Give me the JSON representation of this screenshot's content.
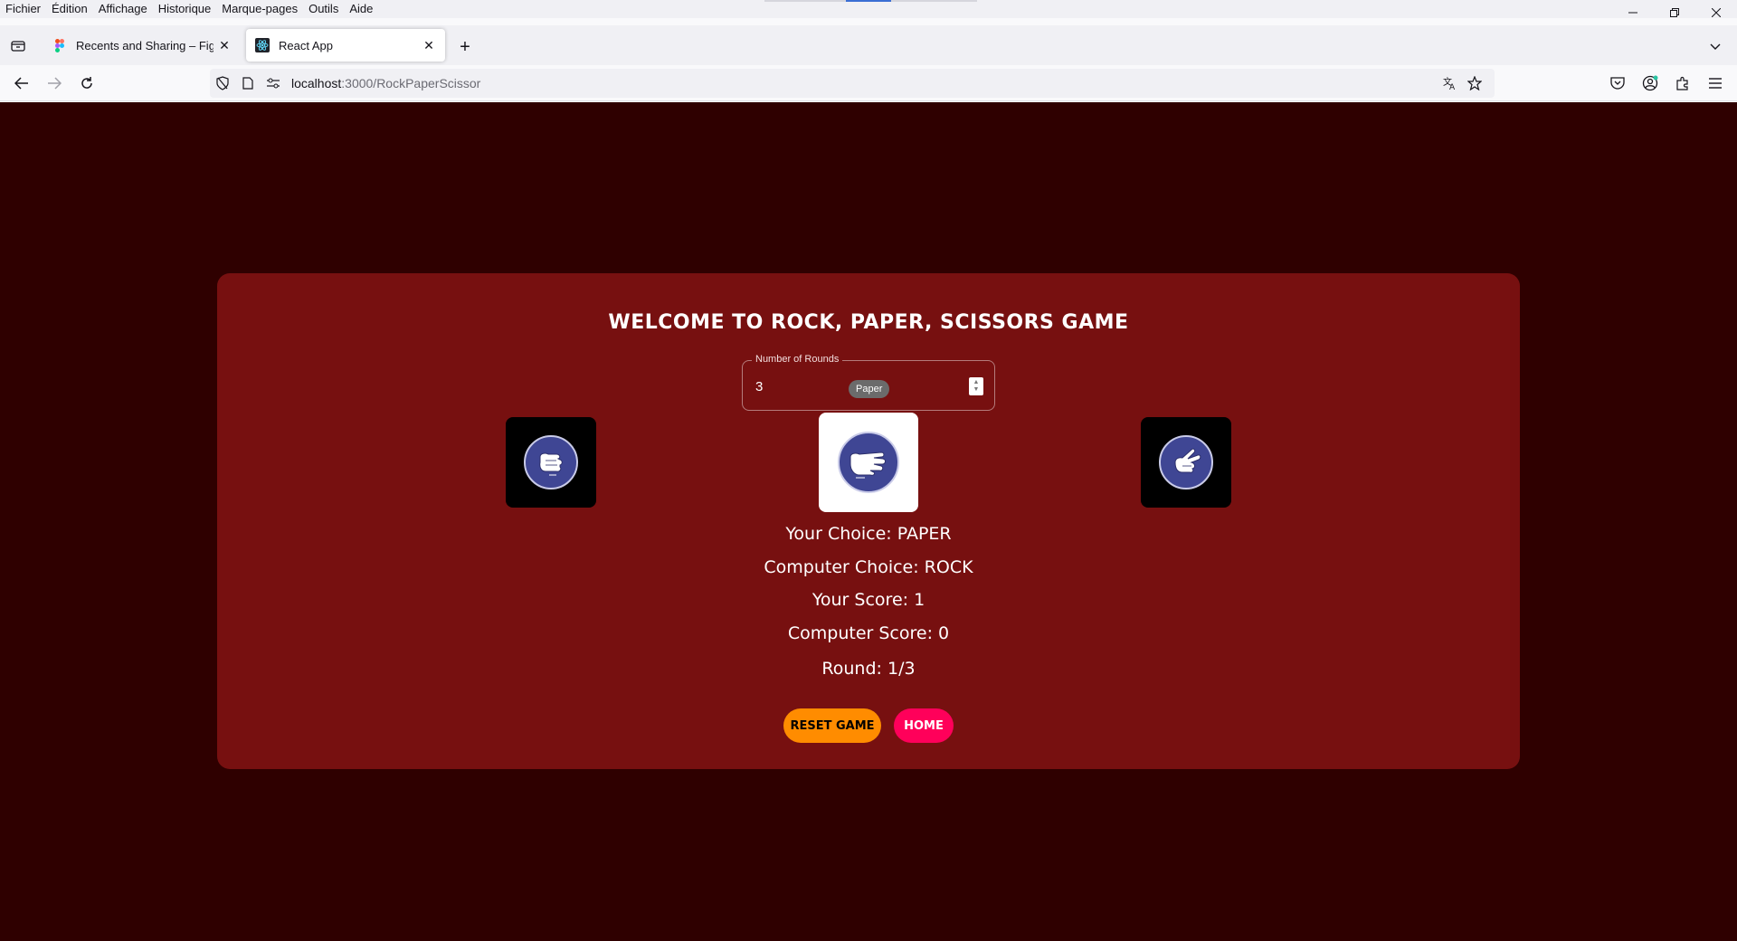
{
  "menubar": {
    "items": [
      "Fichier",
      "Édition",
      "Affichage",
      "Historique",
      "Marque-pages",
      "Outils",
      "Aide"
    ]
  },
  "tabs": [
    {
      "title": "Recents and Sharing – Figma",
      "favicon": "figma-icon",
      "active": false
    },
    {
      "title": "React App",
      "favicon": "react-icon",
      "active": true
    }
  ],
  "address": {
    "host": "localhost",
    "path": ":3000/RockPaperScissor"
  },
  "game": {
    "title": "WELCOME TO ROCK, PAPER, SCISSORS GAME",
    "rounds_label": "Number of Rounds",
    "rounds_value": "3",
    "tooltip": "Paper",
    "choices": [
      {
        "name": "rock",
        "icon": "rock-hand-icon",
        "selected": false
      },
      {
        "name": "paper",
        "icon": "paper-hand-icon",
        "selected": true
      },
      {
        "name": "scissors",
        "icon": "scissors-hand-icon",
        "selected": false
      }
    ],
    "your_choice": "Your Choice: PAPER",
    "computer_choice": "Computer Choice: ROCK",
    "your_score": "Your Score: 1",
    "computer_score": "Computer Score: 0",
    "round": "Round: 1/3",
    "reset_label": "RESET GAME",
    "home_label": "HOME"
  },
  "colors": {
    "page_bg": "#2f0000",
    "card_bg": "#771010",
    "reset_button": "#ff8c00",
    "home_button": "#ff005a",
    "choice_circle": "#3f4694"
  }
}
